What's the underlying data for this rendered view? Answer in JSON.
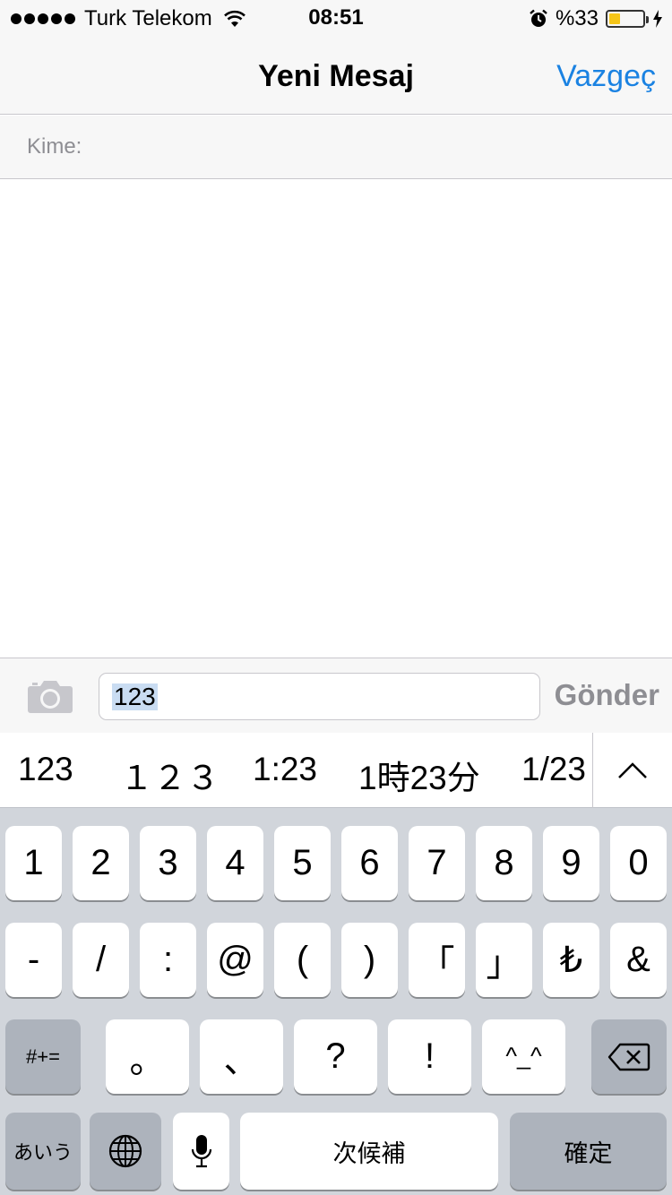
{
  "status_bar": {
    "carrier": "Turk Telekom",
    "time": "08:51",
    "battery_percent": "%33",
    "battery_level": 0.33,
    "battery_color": "#f5c518"
  },
  "nav": {
    "title": "Yeni Mesaj",
    "cancel_label": "Vazgeç",
    "accent_color": "#1a82e2"
  },
  "recipient": {
    "label": "Kime:"
  },
  "compose": {
    "text": "123",
    "send_label": "Gönder",
    "camera_icon": "camera-icon"
  },
  "candidates": [
    "123",
    "１２３",
    "1:23",
    "1時23分",
    "1/23"
  ],
  "keyboard": {
    "row1": [
      "1",
      "2",
      "3",
      "4",
      "5",
      "6",
      "7",
      "8",
      "9",
      "0"
    ],
    "row2": [
      "-",
      "/",
      ":",
      "@",
      "(",
      ")",
      "「",
      "」",
      "₺",
      "&"
    ],
    "row3_mode": "#+=",
    "row3": [
      "。",
      "、",
      "?",
      "!",
      "^_^"
    ],
    "row4_kana": "あいう",
    "row4_space": "次候補",
    "row4_confirm": "確定",
    "icons": [
      "globe-icon",
      "microphone-icon",
      "backspace-icon",
      "chevron-up-icon"
    ]
  }
}
